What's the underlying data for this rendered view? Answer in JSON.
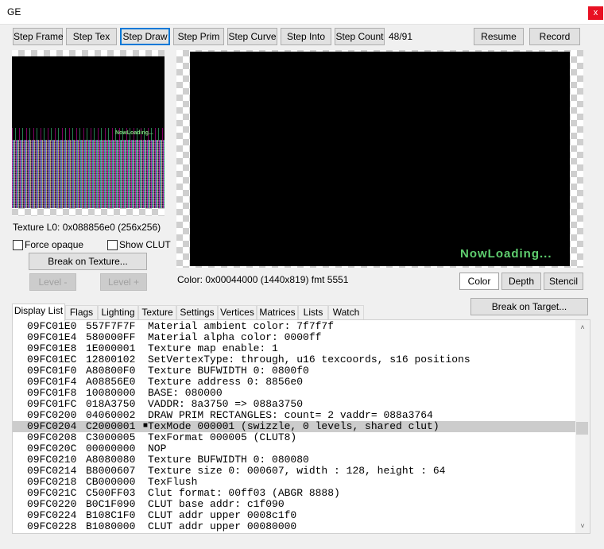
{
  "window": {
    "title": "GE",
    "close_glyph": "x"
  },
  "toolbar": {
    "step_frame": "Step Frame",
    "step_tex": "Step Tex",
    "step_draw": "Step Draw",
    "step_prim": "Step Prim",
    "step_curve": "Step Curve",
    "step_into": "Step Into",
    "step_count": "Step Count",
    "counter": "48/91",
    "resume": "Resume",
    "record": "Record"
  },
  "texture_panel": {
    "info": "Texture L0: 0x088856e0 (256x256)",
    "force_opaque": "Force opaque",
    "show_clut": "Show CLUT",
    "break_on_texture": "Break on Texture...",
    "level_minus": "Level -",
    "level_plus": "Level +",
    "overlay_text": "NowLoading..."
  },
  "frame_panel": {
    "info": "Color: 0x00044000 (1440x819) fmt 5551",
    "overlay_text": "NowLoading...",
    "buttons": {
      "color": "Color",
      "depth": "Depth",
      "stencil": "Stencil"
    },
    "break_on_target": "Break on Target..."
  },
  "tabs": [
    "Display List",
    "Flags",
    "Lighting",
    "Texture",
    "Settings",
    "Vertices",
    "Matrices",
    "Lists",
    "Watch"
  ],
  "display_list": [
    {
      "addr": "09FC01E0",
      "op": "557F7F7F",
      "desc": "Material ambient color: 7f7f7f"
    },
    {
      "addr": "09FC01E4",
      "op": "580000FF",
      "desc": "Material alpha color: 0000ff"
    },
    {
      "addr": "09FC01E8",
      "op": "1E000001",
      "desc": "Texture map enable: 1"
    },
    {
      "addr": "09FC01EC",
      "op": "12800102",
      "desc": "SetVertexType: through, u16 texcoords, s16 positions"
    },
    {
      "addr": "09FC01F0",
      "op": "A80800F0",
      "desc": "Texture BUFWIDTH 0: 0800f0"
    },
    {
      "addr": "09FC01F4",
      "op": "A08856E0",
      "desc": "Texture address 0: 8856e0"
    },
    {
      "addr": "09FC01F8",
      "op": "10080000",
      "desc": "BASE: 080000"
    },
    {
      "addr": "09FC01FC",
      "op": "018A3750",
      "desc": "VADDR: 8a3750 => 088a3750"
    },
    {
      "addr": "09FC0200",
      "op": "04060002",
      "desc": "DRAW PRIM RECTANGLES: count= 2 vaddr= 088a3764"
    },
    {
      "addr": "09FC0204",
      "op": "C2000001",
      "desc": "TexMode 000001 (swizzle, 0 levels, shared clut)",
      "selected": true
    },
    {
      "addr": "09FC0208",
      "op": "C3000005",
      "desc": "TexFormat 000005 (CLUT8)"
    },
    {
      "addr": "09FC020C",
      "op": "00000000",
      "desc": "NOP"
    },
    {
      "addr": "09FC0210",
      "op": "A8080080",
      "desc": "Texture BUFWIDTH 0: 080080"
    },
    {
      "addr": "09FC0214",
      "op": "B8000607",
      "desc": "Texture size 0: 000607, width : 128, height : 64"
    },
    {
      "addr": "09FC0218",
      "op": "CB000000",
      "desc": "TexFlush"
    },
    {
      "addr": "09FC021C",
      "op": "C500FF03",
      "desc": "Clut format: 00ff03 (ABGR 8888)"
    },
    {
      "addr": "09FC0220",
      "op": "B0C1F090",
      "desc": "CLUT base addr: c1f090"
    },
    {
      "addr": "09FC0224",
      "op": "B108C1F0",
      "desc": "CLUT addr upper 0008c1f0"
    },
    {
      "addr": "09FC0228",
      "op": "B1080000",
      "desc": "CLUT addr upper 00080000"
    }
  ]
}
